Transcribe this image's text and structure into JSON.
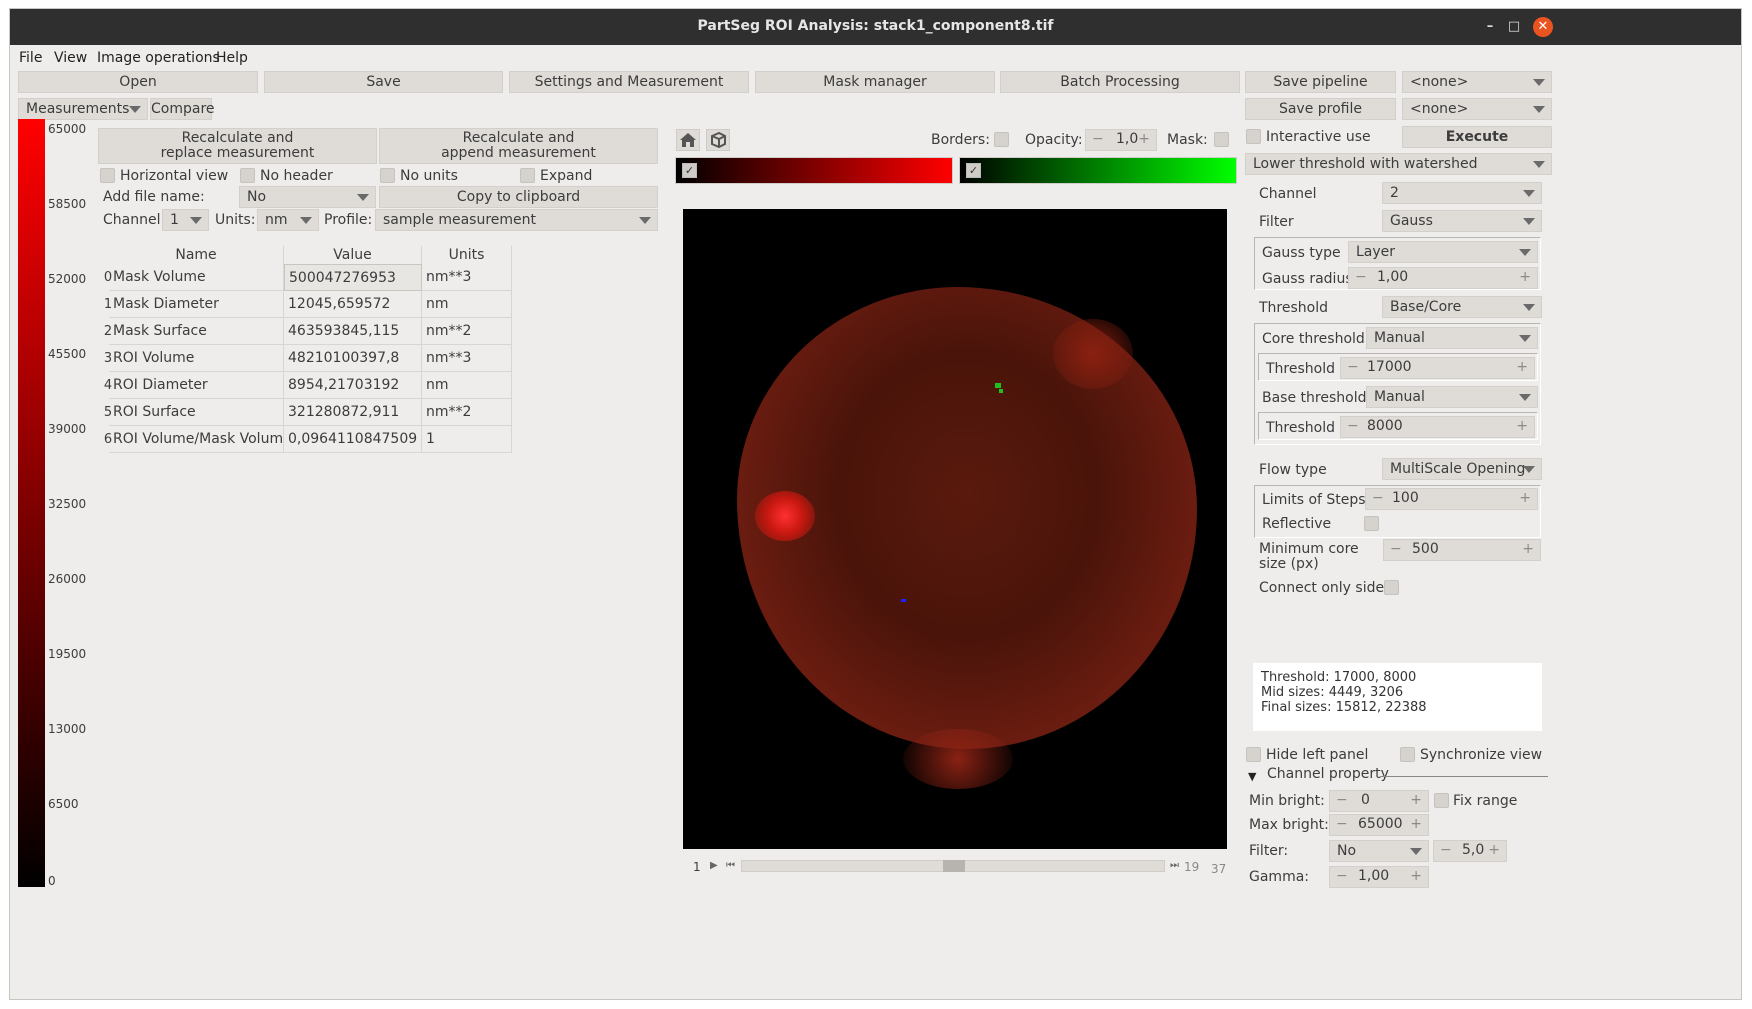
{
  "window": {
    "title": "PartSeg ROI Analysis: stack1_component8.tif",
    "minimize": "–",
    "maximize": "□",
    "close": "✕"
  },
  "menu": [
    "File",
    "View",
    "Image operations",
    "Help"
  ],
  "toolbar": {
    "open": "Open",
    "save": "Save",
    "settings": "Settings and Measurement",
    "mask_manager": "Mask manager",
    "batch": "Batch Processing",
    "save_pipeline": "Save pipeline",
    "pipeline_select": "<none>",
    "save_profile": "Save profile",
    "profile_select": "<none>"
  },
  "left_tabs": {
    "measurements": "Measurements",
    "compare": "Compare"
  },
  "colorbar": {
    "colors": {
      "top": "#ff0000",
      "bottom": "#000000"
    },
    "ticks": [
      "65000",
      "58500",
      "52000",
      "45500",
      "39000",
      "32500",
      "26000",
      "19500",
      "13000",
      "6500",
      "0"
    ]
  },
  "measurement": {
    "recalc_replace": [
      "Recalculate and",
      "replace measurement"
    ],
    "recalc_append": [
      "Recalculate and",
      "append measurement"
    ],
    "horizontal_view": "Horizontal view",
    "no_header": "No header",
    "no_units": "No units",
    "expand": "Expand",
    "add_file_name_label": "Add file name:",
    "add_file_name_value": "No",
    "copy_clipboard": "Copy to clipboard",
    "channel_label": "Channel:",
    "channel_value": "1",
    "units_label": "Units:",
    "units_value": "nm",
    "profile_label": "Profile:",
    "profile_value": "sample measurement",
    "headers": [
      "Name",
      "Value",
      "Units"
    ],
    "rows": [
      {
        "idx": "0",
        "name": "Mask Volume",
        "value": "500047276953",
        "units": "nm**3"
      },
      {
        "idx": "1",
        "name": "Mask Diameter",
        "value": "12045,659572",
        "units": "nm"
      },
      {
        "idx": "2",
        "name": "Mask Surface",
        "value": "463593845,115",
        "units": "nm**2"
      },
      {
        "idx": "3",
        "name": "ROI Volume",
        "value": "48210100397,8",
        "units": "nm**3"
      },
      {
        "idx": "4",
        "name": "ROI Diameter",
        "value": "8954,21703192",
        "units": "nm"
      },
      {
        "idx": "5",
        "name": "ROI Surface",
        "value": "321280872,911",
        "units": "nm**2"
      },
      {
        "idx": "6",
        "name": "ROI Volume/Mask Volume",
        "value": "0,0964110847509",
        "units": "1"
      }
    ]
  },
  "viewer": {
    "home_icon": "home-icon",
    "cube_icon": "3d-cube-icon",
    "borders_label": "Borders:",
    "opacity_label": "Opacity:",
    "opacity_value": "1,0",
    "mask_label": "Mask:",
    "channel_colors": [
      "#ff0000",
      "#00ff00"
    ],
    "slider_left": "1",
    "slider_current": "19",
    "slider_max": "37"
  },
  "algorithm": {
    "interactive_use": "Interactive use",
    "execute": "Execute",
    "method": "Lower threshold with watershed",
    "channel_label": "Channel",
    "channel_value": "2",
    "filter_label": "Filter",
    "filter_value": "Gauss",
    "gauss_type_label": "Gauss type",
    "gauss_type_value": "Layer",
    "gauss_radius_label": "Gauss radius",
    "gauss_radius_value": "1,00",
    "threshold_label": "Threshold",
    "threshold_value": "Base/Core",
    "core_threshold_label": "Core threshold",
    "core_threshold_value": "Manual",
    "core_thr_label": "Threshold",
    "core_thr_value": "17000",
    "base_threshold_label": "Base threshold",
    "base_threshold_value": "Manual",
    "base_thr_label": "Threshold",
    "base_thr_value": "8000",
    "flow_type_label": "Flow type",
    "flow_type_value": "MultiScale Opening",
    "limits_label": "Limits of Steps",
    "limits_value": "100",
    "reflective_label": "Reflective",
    "min_core_label_1": "Minimum core",
    "min_core_label_2": "size (px)",
    "min_core_value": "500",
    "connect_label": "Connect only sides",
    "info": [
      "Threshold: 17000, 8000",
      "Mid sizes: 4449, 3206",
      "Final sizes: 15812, 22388"
    ]
  },
  "bottom_right": {
    "hide_left_panel": "Hide left panel",
    "synchronize_view": "Synchronize view",
    "channel_property": "Channel property",
    "min_bright_label": "Min bright:",
    "min_bright_value": "0",
    "fix_range": "Fix range",
    "max_bright_label": "Max bright:",
    "max_bright_value": "65000",
    "filter_label": "Filter:",
    "filter_value": "No",
    "filter_radius": "5,0",
    "gamma_label": "Gamma:",
    "gamma_value": "1,00"
  }
}
